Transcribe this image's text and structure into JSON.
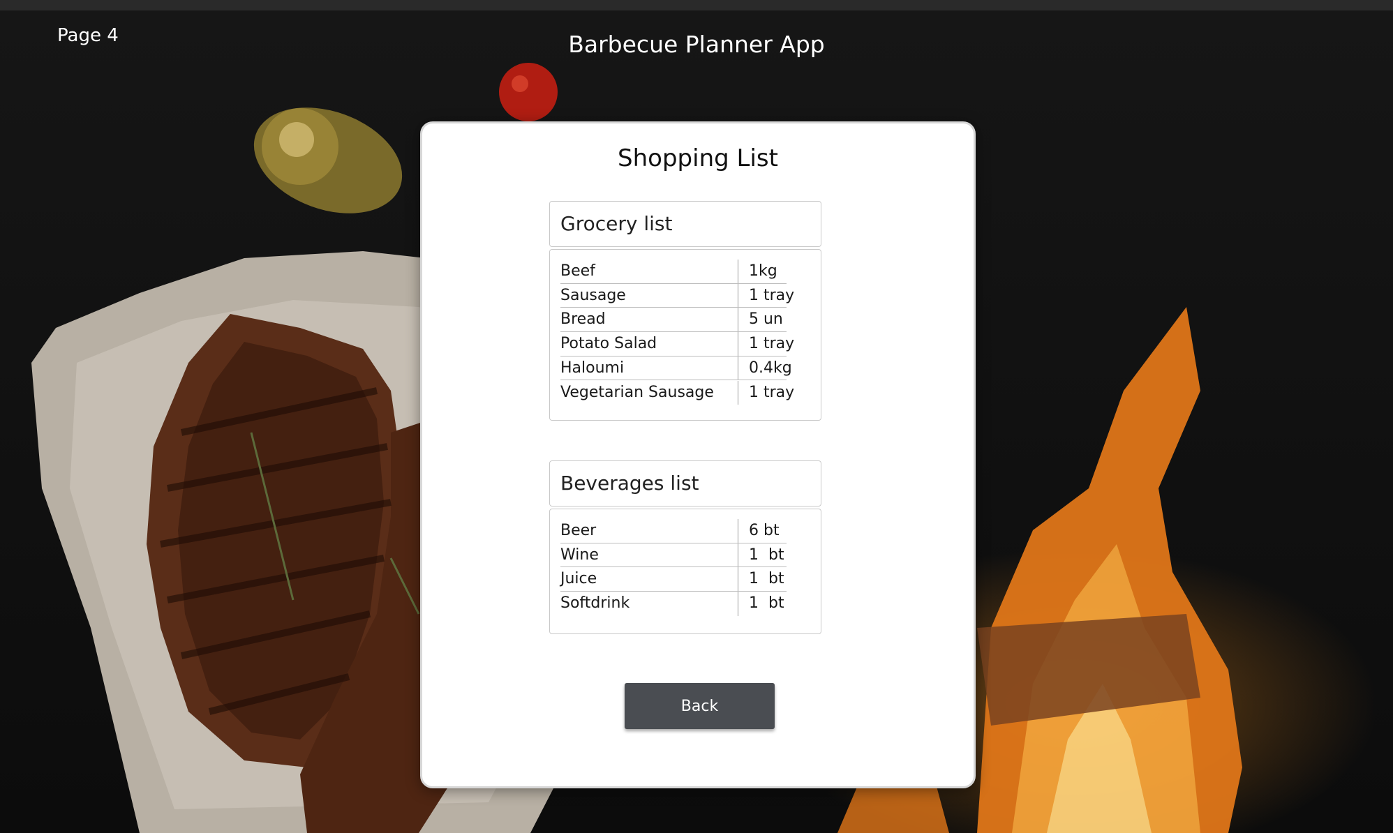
{
  "page": {
    "label": "Page 4"
  },
  "app": {
    "title": "Barbecue Planner App"
  },
  "card": {
    "title": "Shopping List"
  },
  "grocery": {
    "title": "Grocery list",
    "items": [
      {
        "name": "Beef",
        "qty": "1kg"
      },
      {
        "name": "Sausage",
        "qty": "1 tray"
      },
      {
        "name": "Bread",
        "qty": "5 un"
      },
      {
        "name": "Potato Salad",
        "qty": "1 tray"
      },
      {
        "name": "Haloumi",
        "qty": "0.4kg"
      },
      {
        "name": "Vegetarian Sausage",
        "qty": "1 tray"
      }
    ]
  },
  "beverages": {
    "title": "Beverages list",
    "items": [
      {
        "name": "Beer",
        "qty": "6 bt"
      },
      {
        "name": "Wine",
        "qty": "1  bt"
      },
      {
        "name": "Juice",
        "qty": "1  bt"
      },
      {
        "name": "Softdrink",
        "qty": "1  bt"
      }
    ]
  },
  "actions": {
    "back_label": "Back"
  },
  "colors": {
    "card_bg": "#ffffff",
    "button_bg": "#4a4d52",
    "background": "#101010"
  }
}
